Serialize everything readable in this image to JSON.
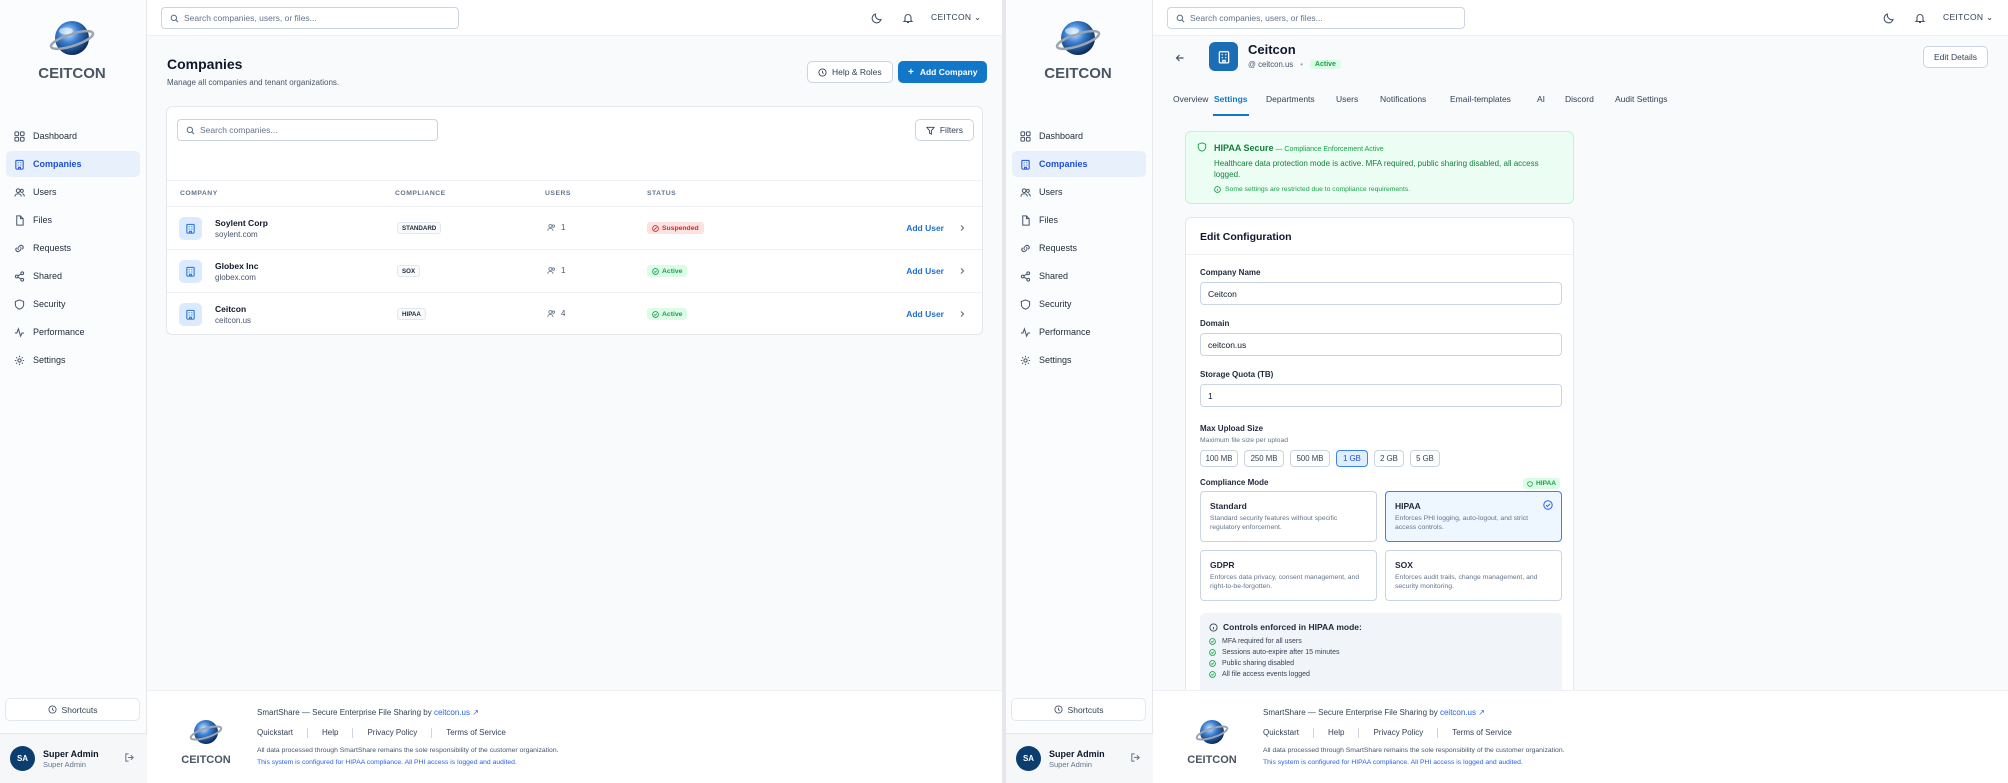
{
  "brand": {
    "name": "CEITCON",
    "accent": "#1277c8"
  },
  "nav": [
    {
      "label": "Dashboard",
      "icon": "dashboard-icon"
    },
    {
      "label": "Companies",
      "icon": "building-icon"
    },
    {
      "label": "Users",
      "icon": "users-icon"
    },
    {
      "label": "Files",
      "icon": "file-icon"
    },
    {
      "label": "Requests",
      "icon": "link-icon"
    },
    {
      "label": "Shared",
      "icon": "share-icon"
    },
    {
      "label": "Security",
      "icon": "shield-icon"
    },
    {
      "label": "Performance",
      "icon": "activity-icon"
    },
    {
      "label": "Settings",
      "icon": "gear-icon"
    }
  ],
  "shortcuts_label": "Shortcuts",
  "user": {
    "initials": "SA",
    "name": "Super Admin",
    "role": "Super Admin"
  },
  "topbar": {
    "search_placeholder": "Search companies, users, or files...",
    "tenant": "CEITCON"
  },
  "footer": {
    "tagline": "SmartShare — Secure Enterprise File Sharing by ",
    "tagline_link": "ceitcon.us",
    "links": [
      "Quickstart",
      "Help",
      "Privacy Policy",
      "Terms of Service"
    ],
    "note": "All data processed through SmartShare remains the sole responsibility of the customer organization.",
    "note2": "This system is configured for HIPAA compliance. All PHI access is logged and audited."
  },
  "companies_page": {
    "title": "Companies",
    "subtitle": "Manage all companies and tenant organizations.",
    "help_button": "Help & Roles",
    "add_button": "Add Company",
    "search_placeholder": "Search companies...",
    "filters_button": "Filters",
    "columns": [
      "COMPANY",
      "COMPLIANCE",
      "USERS",
      "STATUS"
    ],
    "rows": [
      {
        "name": "Soylent Corp",
        "domain": "soylent.com",
        "compliance": "STANDARD",
        "users": "1",
        "status": "Suspended",
        "status_kind": "red",
        "action": "Add User"
      },
      {
        "name": "Globex Inc",
        "domain": "globex.com",
        "compliance": "SOX",
        "users": "1",
        "status": "Active",
        "status_kind": "green",
        "action": "Add User"
      },
      {
        "name": "Ceitcon",
        "domain": "ceitcon.us",
        "compliance": "HIPAA",
        "users": "4",
        "status": "Active",
        "status_kind": "green",
        "action": "Add User"
      }
    ]
  },
  "detail_page": {
    "name": "Ceitcon",
    "domain": "@ ceitcon.us",
    "status": "Active",
    "edit_button": "Edit Details",
    "tabs": [
      "Overview",
      "Settings",
      "Departments",
      "Users",
      "Notifications",
      "Email-templates",
      "AI",
      "Discord",
      "Audit Settings"
    ],
    "active_tab": "Settings",
    "hipaa_banner": {
      "title": "HIPAA Secure",
      "title_note": " — Compliance Enforcement Active",
      "body": "Healthcare data protection mode is active. MFA required, public sharing disabled, all access logged.",
      "note": "Some settings are restricted due to compliance requirements."
    },
    "config": {
      "title": "Edit Configuration",
      "company_name_label": "Company Name",
      "company_name_value": "Ceitcon",
      "domain_label": "Domain",
      "domain_value": "ceitcon.us",
      "quota_label": "Storage Quota (TB)",
      "quota_value": "1",
      "upload_label": "Max Upload Size",
      "upload_hint": "Maximum file size per upload",
      "upload_options": [
        "100 MB",
        "250 MB",
        "500 MB",
        "1 GB",
        "2 GB",
        "5 GB"
      ],
      "upload_selected": "1 GB",
      "compliance_label": "Compliance Mode",
      "compliance_badge": "HIPAA",
      "modes": [
        {
          "title": "Standard",
          "desc": "Standard security features without specific regulatory enforcement."
        },
        {
          "title": "HIPAA",
          "desc": "Enforces PHI logging, auto-logout, and strict access controls."
        },
        {
          "title": "GDPR",
          "desc": "Enforces data privacy, consent management, and right-to-be-forgotten."
        },
        {
          "title": "SOX",
          "desc": "Enforces audit trails, change management, and security monitoring."
        }
      ],
      "selected_mode": "HIPAA",
      "controls_title": "Controls enforced in HIPAA mode:",
      "controls": [
        "MFA required for all users",
        "Sessions auto-expire after 15 minutes",
        "Public sharing disabled",
        "All file access events logged"
      ]
    }
  }
}
